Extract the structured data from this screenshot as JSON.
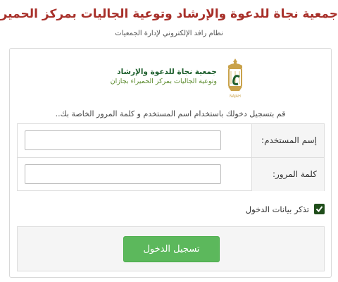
{
  "header": {
    "title": "جمعية نجاة للدعوة والإرشاد وتوعية الجاليات بمركز الحميراء",
    "subtitle": "نظام رافد الإلكتروني لإدارة الجمعيات"
  },
  "logo": {
    "line1": "جمعية نجاة للدعوة والإرشاد",
    "line2": "وتوعية الجاليات بمركز الحميراء بجازان",
    "emblem_letter": "نجاة",
    "emblem_caption": "NAJAH"
  },
  "login": {
    "intro": "قم بتسجيل دخولك باستخدام اسم المستخدم و كلمة المرور الخاصة بك..",
    "username_label": "إسم المستخدم:",
    "username_value": "",
    "password_label": "كلمة المرور:",
    "password_value": "",
    "remember_label": "تذكر بيانات الدخول",
    "remember_checked": true,
    "submit_label": "تسجيل الدخول"
  },
  "colors": {
    "title": "#a8302a",
    "button": "#5cb85c",
    "checkbox": "#1f4d1a",
    "logo_green": "#1c5e2c"
  }
}
